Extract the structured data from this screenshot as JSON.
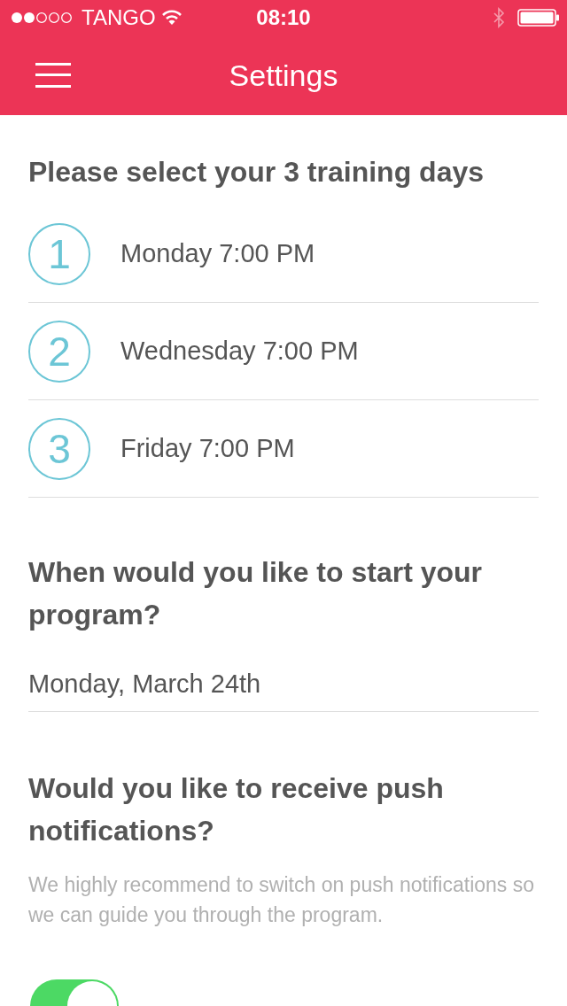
{
  "status_bar": {
    "carrier": "TANGO",
    "time": "08:10"
  },
  "nav": {
    "title": "Settings"
  },
  "training": {
    "heading": "Please select your 3 training days",
    "days": [
      {
        "number": "1",
        "label": "Monday 7:00 PM"
      },
      {
        "number": "2",
        "label": "Wednesday 7:00 PM"
      },
      {
        "number": "3",
        "label": "Friday 7:00 PM"
      }
    ]
  },
  "start": {
    "heading": "When would you like to start your program?",
    "date": "Monday, March 24th"
  },
  "notifications": {
    "heading": "Would you like to receive push notifications?",
    "description": "We highly recommend to switch on push notifications so we can guide you through the program.",
    "on": true
  }
}
